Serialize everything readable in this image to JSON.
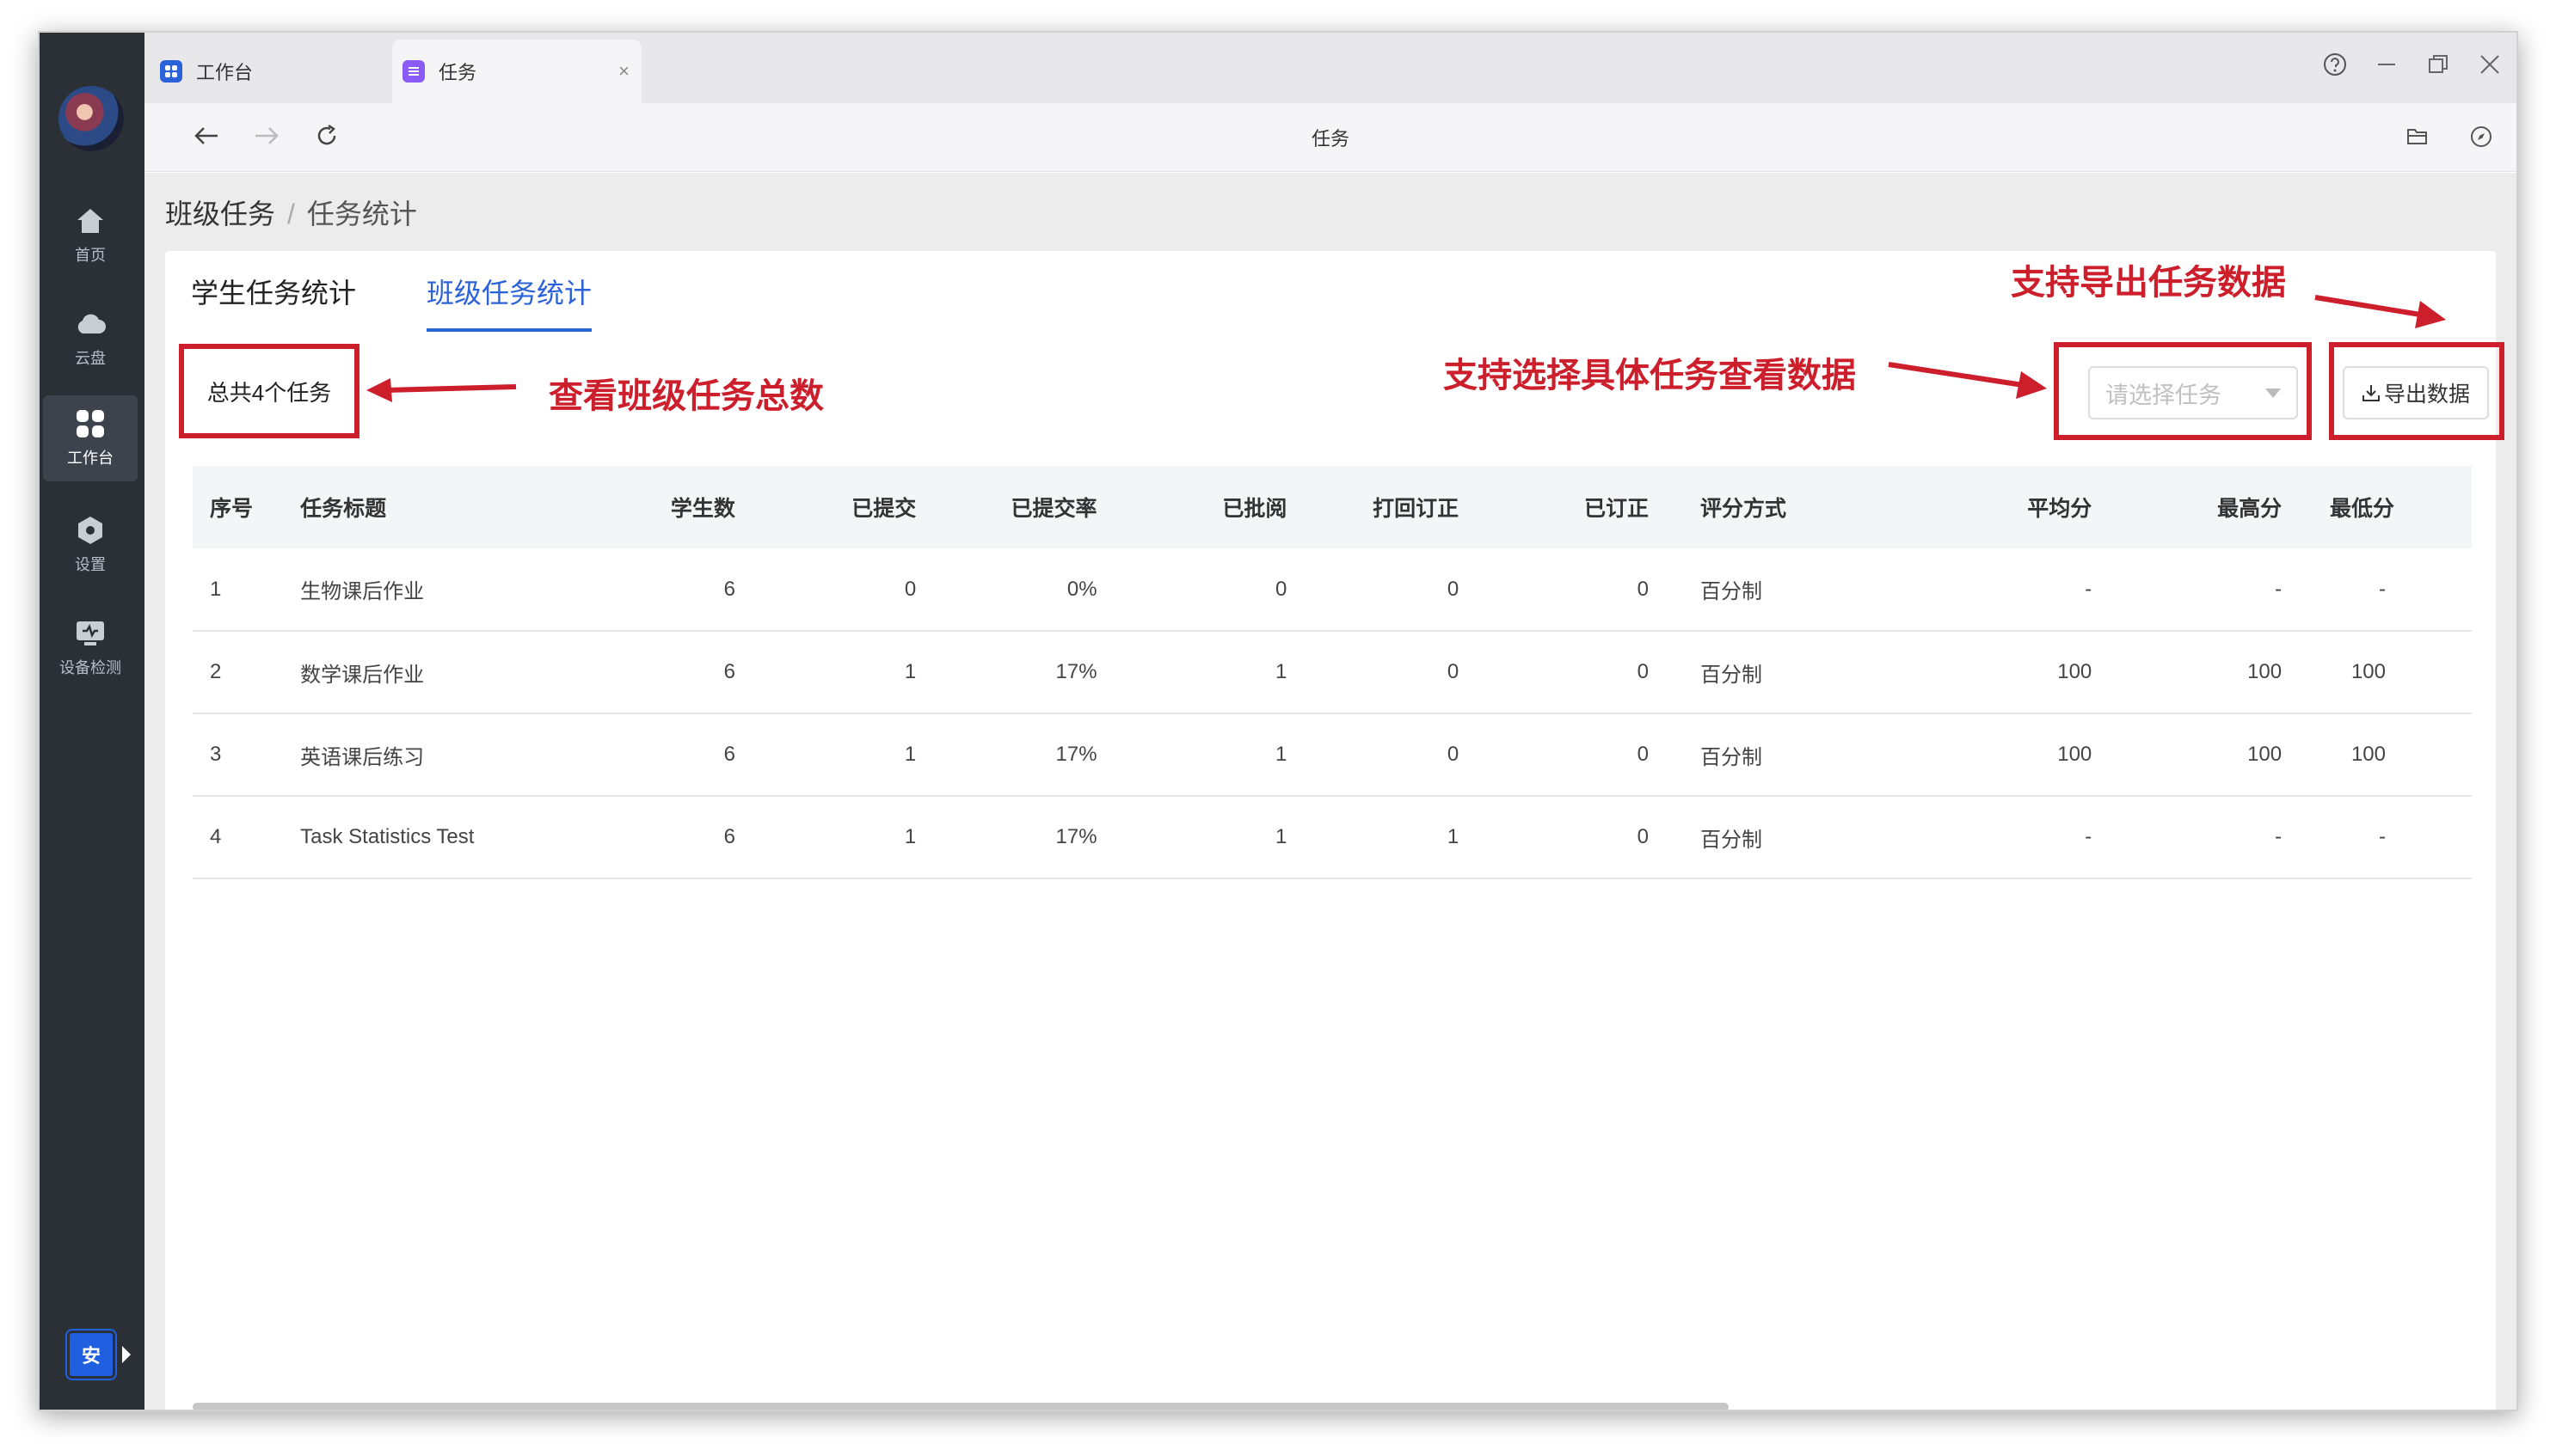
{
  "app": {
    "tabs": [
      {
        "label": "工作台",
        "icon": "grid-icon",
        "color": "#2b62d9"
      },
      {
        "label": "任务",
        "icon": "task-icon",
        "color": "#8a5cf5"
      }
    ],
    "close_glyph": "×",
    "page_title": "任务"
  },
  "sidebar": {
    "items": [
      {
        "label": "首页",
        "icon": "home-icon"
      },
      {
        "label": "云盘",
        "icon": "cloud-icon"
      },
      {
        "label": "工作台",
        "icon": "grid-icon",
        "active": true
      },
      {
        "label": "设置",
        "icon": "settings-icon"
      },
      {
        "label": "设备检测",
        "icon": "device-check-icon"
      }
    ],
    "safe_label": "安"
  },
  "breadcrumb": {
    "root": "班级任务",
    "sep": "/",
    "current": "任务统计"
  },
  "sub_tabs": [
    {
      "label": "学生任务统计",
      "active": false
    },
    {
      "label": "班级任务统计",
      "active": true
    }
  ],
  "summary": {
    "total_label": "总共4个任务"
  },
  "filter": {
    "placeholder": "请选择任务",
    "export_label": "导出数据"
  },
  "annotations": {
    "total": "查看班级任务总数",
    "select": "支持选择具体任务查看数据",
    "export": "支持导出任务数据"
  },
  "table": {
    "headers": [
      "序号",
      "任务标题",
      "学生数",
      "已提交",
      "已提交率",
      "已批阅",
      "打回订正",
      "已订正",
      "评分方式",
      "平均分",
      "最高分",
      "最低分"
    ],
    "rows": [
      [
        "1",
        "生物课后作业",
        "6",
        "0",
        "0%",
        "0",
        "0",
        "0",
        "百分制",
        "-",
        "-",
        "-"
      ],
      [
        "2",
        "数学课后作业",
        "6",
        "1",
        "17%",
        "1",
        "0",
        "0",
        "百分制",
        "100",
        "100",
        "100"
      ],
      [
        "3",
        "英语课后练习",
        "6",
        "1",
        "17%",
        "1",
        "0",
        "0",
        "百分制",
        "100",
        "100",
        "100"
      ],
      [
        "4",
        "Task Statistics Test",
        "6",
        "1",
        "17%",
        "1",
        "1",
        "0",
        "百分制",
        "-",
        "-",
        "-"
      ]
    ]
  },
  "colors": {
    "accent": "#2b62d9",
    "annotation": "#cc1e2b",
    "sidebar": "#2b2f36"
  }
}
